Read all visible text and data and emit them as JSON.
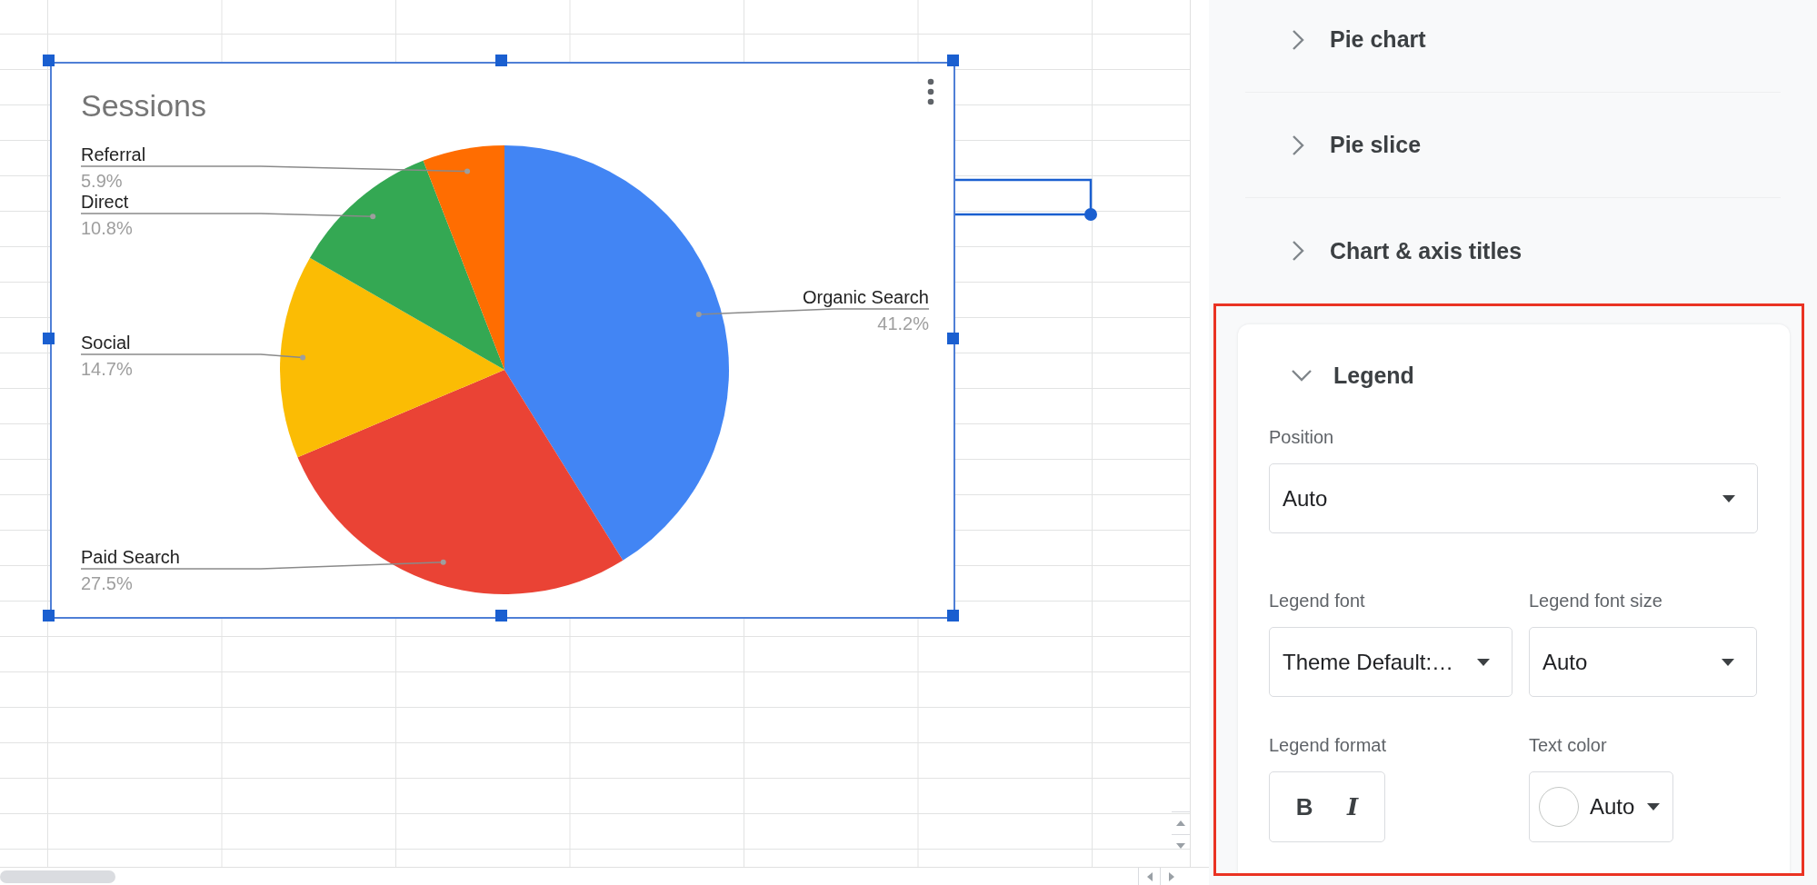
{
  "chart": {
    "chart_data": {
      "type": "pie",
      "title": "Sessions",
      "categories": [
        "Organic Search",
        "Paid Search",
        "Social",
        "Direct",
        "Referral"
      ],
      "values": [
        41.2,
        27.5,
        14.7,
        10.8,
        5.9
      ],
      "colors": [
        "#4285f4",
        "#ea4335",
        "#fbbc04",
        "#34a853",
        "#ff6d01"
      ],
      "value_labels": [
        "41.2%",
        "27.5%",
        "14.7%",
        "10.8%",
        "5.9%"
      ]
    }
  },
  "panel": {
    "sections": [
      {
        "label": "Pie chart",
        "expanded": false
      },
      {
        "label": "Pie slice",
        "expanded": false
      },
      {
        "label": "Chart & axis titles",
        "expanded": false
      }
    ],
    "legend": {
      "title": "Legend",
      "expanded": true,
      "highlighted": true,
      "position": {
        "label": "Position",
        "value": "Auto"
      },
      "font": {
        "label": "Legend font",
        "value": "Theme Default:…"
      },
      "font_size": {
        "label": "Legend font size",
        "value": "Auto"
      },
      "format": {
        "label": "Legend format",
        "bold": {
          "text": "B",
          "selected": false
        },
        "italic": {
          "text": "I",
          "selected": false
        }
      },
      "text_color": {
        "label": "Text color",
        "value": "Auto"
      }
    }
  }
}
